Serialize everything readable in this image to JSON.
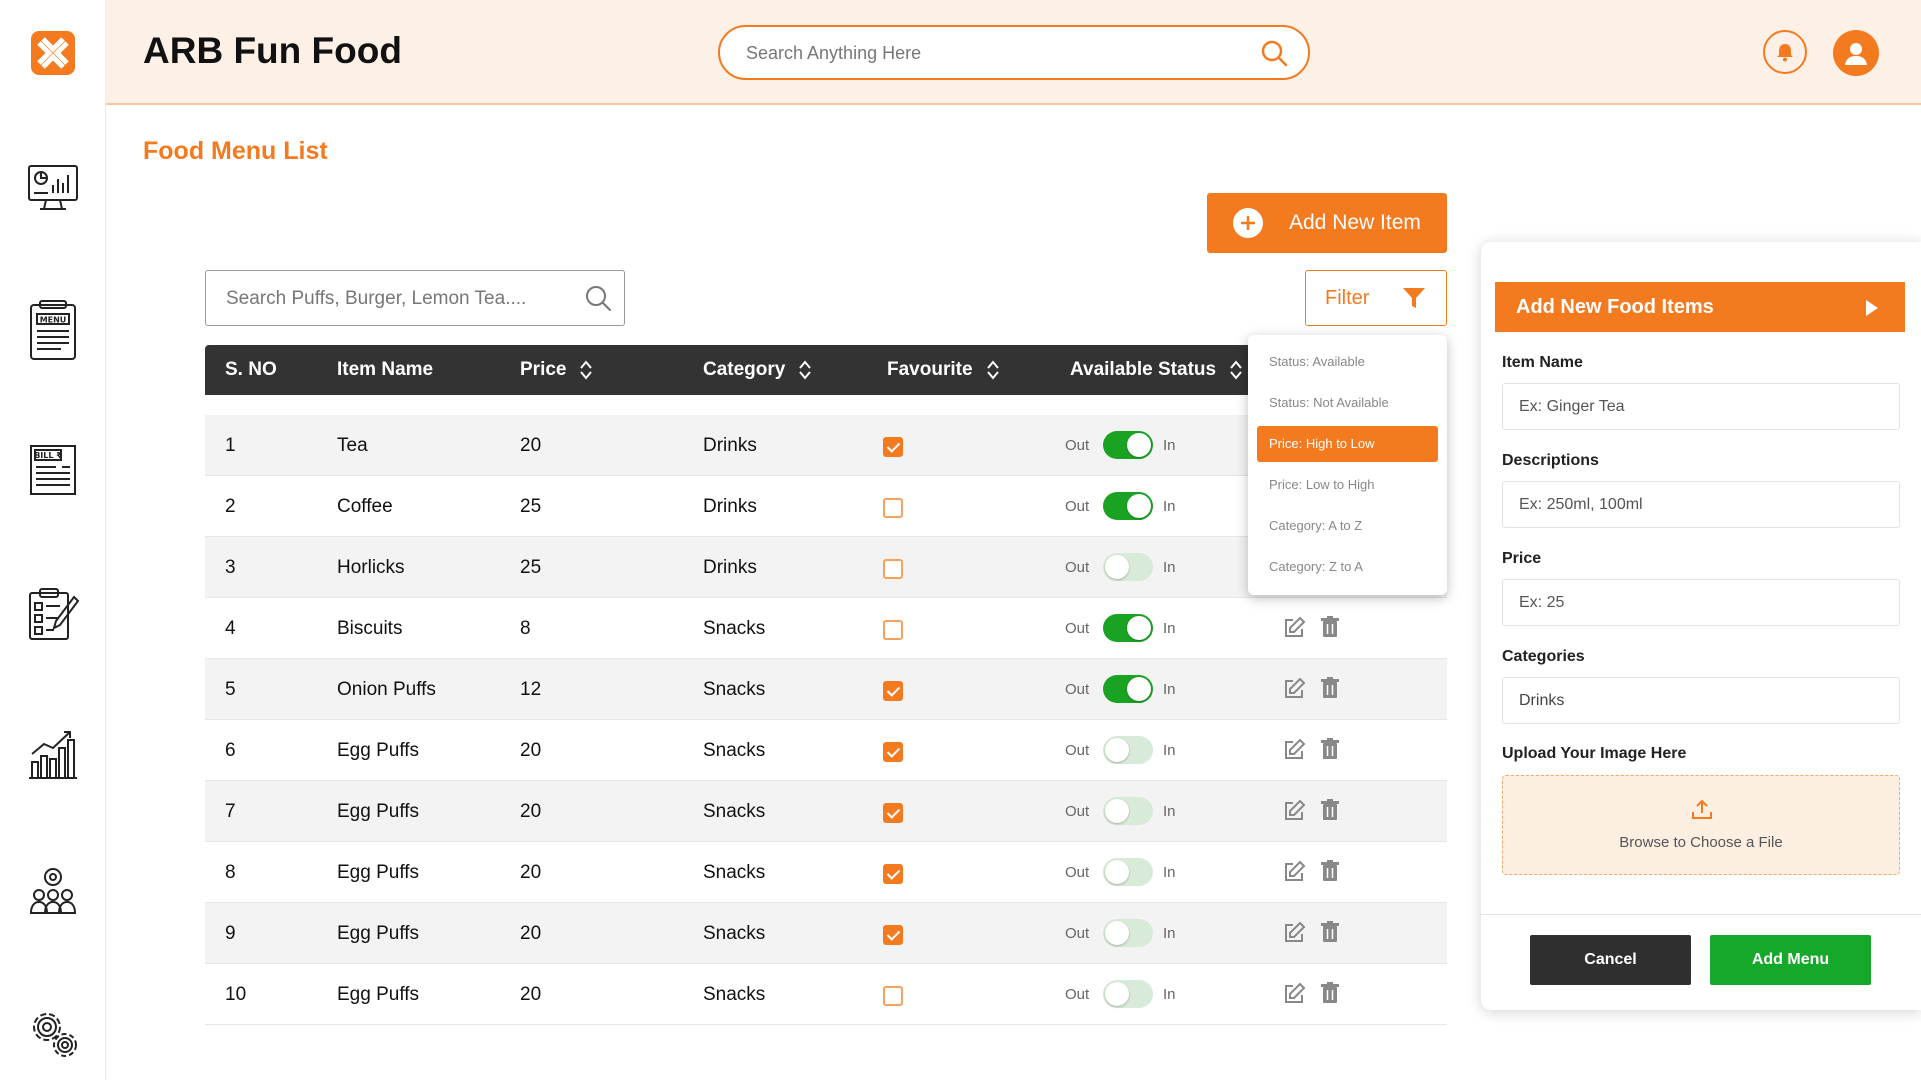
{
  "header": {
    "app_title": "ARB Fun Food",
    "search_placeholder": "Search Anything Here",
    "icons": {
      "logo": "brand-logo",
      "search": "search-icon",
      "notification": "bell-icon",
      "user": "user-icon"
    }
  },
  "sidebar": {
    "items": [
      {
        "icon": "dashboard-icon"
      },
      {
        "icon": "menu-icon",
        "text": "MENU"
      },
      {
        "icon": "bill-icon",
        "text": "BILL ₹"
      },
      {
        "icon": "orders-icon"
      },
      {
        "icon": "reports-icon"
      },
      {
        "icon": "staff-icon"
      },
      {
        "icon": "settings-icon"
      }
    ]
  },
  "main": {
    "page_title": "Food Menu List",
    "add_new_label": "Add New Item",
    "list_search_placeholder": "Search Puffs, Burger, Lemon Tea....",
    "filter_label": "Filter"
  },
  "table": {
    "columns": [
      "S. NO",
      "Item Name",
      "Price",
      "Category",
      "Favourite",
      "Available Status"
    ],
    "out_label": "Out",
    "in_label": "In",
    "rows": [
      {
        "sno": "1",
        "name": "Tea",
        "price": "20",
        "category": "Drinks",
        "favourite": true,
        "available": true
      },
      {
        "sno": "2",
        "name": "Coffee",
        "price": "25",
        "category": "Drinks",
        "favourite": false,
        "available": true
      },
      {
        "sno": "3",
        "name": "Horlicks",
        "price": "25",
        "category": "Drinks",
        "favourite": false,
        "available": false
      },
      {
        "sno": "4",
        "name": "Biscuits",
        "price": "8",
        "category": "Snacks",
        "favourite": false,
        "available": true
      },
      {
        "sno": "5",
        "name": "Onion Puffs",
        "price": "12",
        "category": "Snacks",
        "favourite": true,
        "available": true
      },
      {
        "sno": "6",
        "name": "Egg Puffs",
        "price": "20",
        "category": "Snacks",
        "favourite": true,
        "available": false
      },
      {
        "sno": "7",
        "name": "Egg Puffs",
        "price": "20",
        "category": "Snacks",
        "favourite": true,
        "available": false
      },
      {
        "sno": "8",
        "name": "Egg Puffs",
        "price": "20",
        "category": "Snacks",
        "favourite": true,
        "available": false
      },
      {
        "sno": "9",
        "name": "Egg Puffs",
        "price": "20",
        "category": "Snacks",
        "favourite": true,
        "available": false
      },
      {
        "sno": "10",
        "name": "Egg Puffs",
        "price": "20",
        "category": "Snacks",
        "favourite": false,
        "available": false
      }
    ]
  },
  "filter_dropdown": {
    "options": [
      {
        "label": "Status: Available",
        "active": false
      },
      {
        "label": "Status: Not Available",
        "active": false
      },
      {
        "label": "Price: High to Low",
        "active": true
      },
      {
        "label": "Price: Low to High",
        "active": false
      },
      {
        "label": "Category: A to Z",
        "active": false
      },
      {
        "label": "Category: Z to A",
        "active": false
      }
    ]
  },
  "panel": {
    "title": "Add New Food Items",
    "item_name_label": "Item Name",
    "item_name_placeholder": "Ex: Ginger Tea",
    "descriptions_label": "Descriptions",
    "descriptions_placeholder": "Ex: 250ml, 100ml",
    "price_label": "Price",
    "price_placeholder": "Ex: 25",
    "categories_label": "Categories",
    "categories_value": "Drinks",
    "upload_label": "Upload Your Image Here",
    "upload_text": "Browse to Choose a File",
    "cancel_label": "Cancel",
    "add_menu_label": "Add Menu"
  },
  "colors": {
    "accent": "#f47a1f",
    "header_bg": "#fdf1e7",
    "toggle_on": "#1aa323",
    "add_menu": "#16a82a",
    "table_head": "#333333"
  }
}
